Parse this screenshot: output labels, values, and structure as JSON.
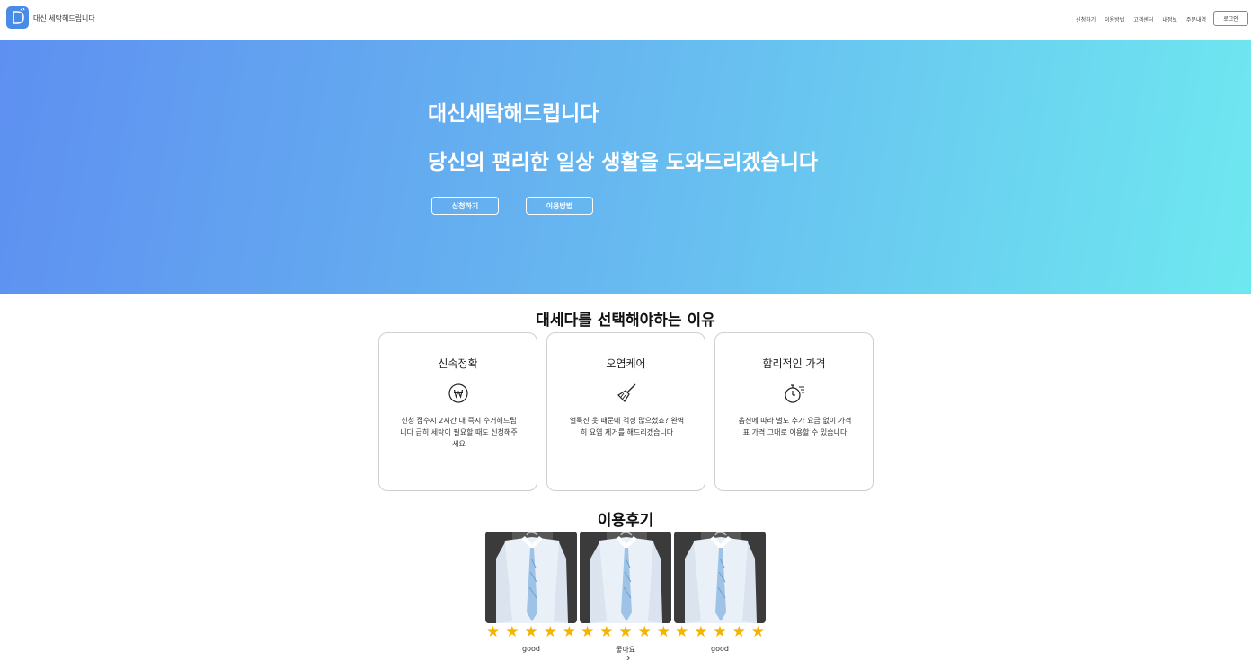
{
  "header": {
    "brand": "대신 세탁해드립니다",
    "nav": [
      "신청하기",
      "이용방법",
      "고객센터",
      "내정보",
      "주문내역"
    ],
    "login_label": "로그인"
  },
  "hero": {
    "title": "대신세탁해드립니다",
    "subtitle": "당신의 편리한 일상 생활을 도와드리겠습니다",
    "apply_label": "신청하기",
    "howto_label": "이용방법"
  },
  "reasons": {
    "title": "대세다를 선택해야하는 이유",
    "cards": [
      {
        "title": "신속정확",
        "icon": "won-coin-icon",
        "desc": "신청 접수시 2시간 내 즉시 수거해드립니다 급히 세탁이 필요할 때도 신청해주세요"
      },
      {
        "title": "오염케어",
        "icon": "broom-icon",
        "desc": "얼룩진 옷 때문에 걱정 많으셨죠? 완벽히 요염 제거를 해드리겠습니다"
      },
      {
        "title": "합리적인 가격",
        "icon": "stopwatch-icon",
        "desc": "옵션에 따라 별도 추가 요금 없이 가격표 가격 그대로 이용할 수 있습니다"
      }
    ]
  },
  "reviews": {
    "title": "이용후기",
    "items": [
      {
        "rating": 5,
        "text": "good"
      },
      {
        "rating": 5,
        "text": "좋아요"
      },
      {
        "rating": 5,
        "text": "good"
      }
    ]
  },
  "colors": {
    "hero_start": "#5e90f1",
    "hero_end": "#6ee8f0",
    "logo": "#4a8be6",
    "star": "#f5b400"
  }
}
